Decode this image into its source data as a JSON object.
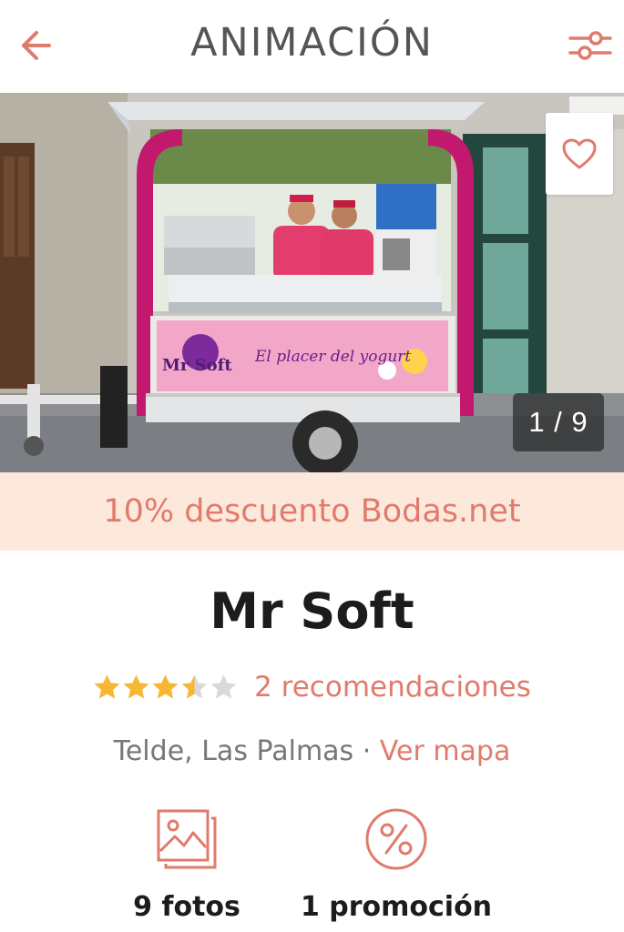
{
  "header": {
    "title": "ANIMACIÓN",
    "back_icon": "arrow-left-icon",
    "filter_icon": "sliders-icon"
  },
  "hero": {
    "counter": "1 / 9",
    "favorite_icon": "heart-icon",
    "truck_sign_brand": "Mr Soft",
    "truck_sign_slogan": "El placer del yogurt"
  },
  "discount": {
    "text": "10% descuento Bodas.net"
  },
  "vendor": {
    "name": "Mr Soft",
    "rating": 3.5,
    "rating_max": 5,
    "recommendations": "2 recomendaciones",
    "location": "Telde, Las Palmas",
    "separator": " · ",
    "map_link": "Ver mapa"
  },
  "stats": {
    "photos_label": "9 fotos",
    "photos_icon": "photo-gallery-icon",
    "promo_label": "1 promoción",
    "promo_icon": "percent-icon"
  },
  "colors": {
    "accent": "#e07b6c",
    "discount_bg": "#fde9dc",
    "star": "#f7b731",
    "star_empty": "#d9d9d9"
  }
}
